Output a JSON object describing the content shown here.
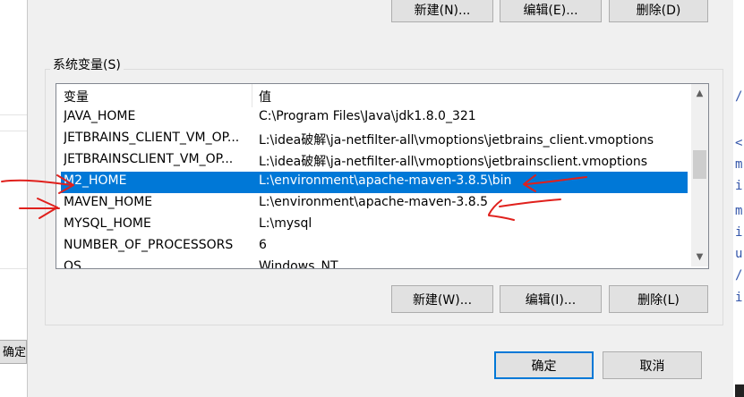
{
  "top_buttons": {
    "new": "新建(N)...",
    "edit": "编辑(E)...",
    "delete": "删除(D)"
  },
  "group_label": "系统变量(S)",
  "columns": {
    "name": "变量",
    "value": "值"
  },
  "rows": [
    {
      "name": "JAVA_HOME",
      "value": "C:\\Program Files\\Java\\jdk1.8.0_321",
      "selected": false
    },
    {
      "name": "JETBRAINS_CLIENT_VM_OP...",
      "value": "L:\\idea破解\\ja-netfilter-all\\vmoptions\\jetbrains_client.vmoptions",
      "selected": false
    },
    {
      "name": "JETBRAINSCLIENT_VM_OP...",
      "value": "L:\\idea破解\\ja-netfilter-all\\vmoptions\\jetbrainsclient.vmoptions",
      "selected": false
    },
    {
      "name": "M2_HOME",
      "value": "L:\\environment\\apache-maven-3.8.5\\bin",
      "selected": true
    },
    {
      "name": "MAVEN_HOME",
      "value": "L:\\environment\\apache-maven-3.8.5",
      "selected": false
    },
    {
      "name": "MYSQL_HOME",
      "value": "L:\\mysql",
      "selected": false
    },
    {
      "name": "NUMBER_OF_PROCESSORS",
      "value": "6",
      "selected": false
    },
    {
      "name": "OS",
      "value": "Windows_NT",
      "selected": false
    }
  ],
  "bottom_buttons": {
    "new": "新建(W)...",
    "edit": "编辑(I)...",
    "delete": "删除(L)"
  },
  "dialog_buttons": {
    "ok": "确定",
    "cancel": "取消"
  },
  "background_window": {
    "ok_peek": "确定"
  },
  "colors": {
    "selection": "#0078d7",
    "annotation": "#e0201c",
    "dialog_bg": "#f0f0f0",
    "button_bg": "#e1e1e1"
  }
}
